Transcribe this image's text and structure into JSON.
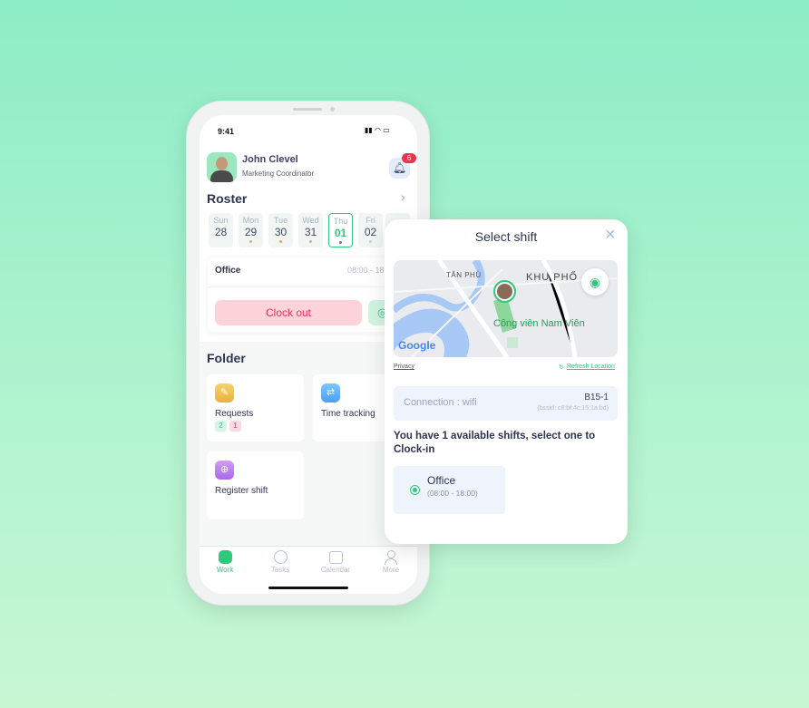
{
  "status_bar": {
    "time": "9:41"
  },
  "user": {
    "name": "John Clevel",
    "role": "Marketing Coordinator",
    "notification_count": "6"
  },
  "roster": {
    "title": "Roster",
    "days": [
      {
        "dow": "Sun",
        "date": "28",
        "dot": ""
      },
      {
        "dow": "Mon",
        "date": "29",
        "dot": "#f5a36b"
      },
      {
        "dow": "Tue",
        "date": "30",
        "dot": "#f5a36b"
      },
      {
        "dow": "Wed",
        "date": "31",
        "dot": "#f5a36b"
      },
      {
        "dow": "Thu",
        "date": "01",
        "dot": "#6b7489",
        "selected": true
      },
      {
        "dow": "Fri",
        "date": "02",
        "dot": "#c9d0d6"
      }
    ],
    "shift_name": "Office",
    "shift_time": "08:00 - 18:00",
    "clock_out_label": "Clock out"
  },
  "folder": {
    "title": "Folder",
    "items": [
      {
        "label": "Requests",
        "badges": [
          "2",
          "1"
        ],
        "icon": "requests-icon"
      },
      {
        "label": "Time tracking",
        "icon": "time-tracking-icon"
      },
      {
        "label": "Register shift",
        "icon": "register-shift-icon"
      }
    ]
  },
  "bottom_nav": [
    {
      "label": "Work",
      "active": true
    },
    {
      "label": "Tasks"
    },
    {
      "label": "Calendar"
    },
    {
      "label": "More"
    }
  ],
  "modal": {
    "title": "Select shift",
    "map": {
      "labels": [
        "TÂN PHÚ",
        "KHU PHỐ",
        "Công viên Nam Viên"
      ],
      "logo": "Google"
    },
    "privacy": "Privacy",
    "refresh": "Refresh Location",
    "connection": {
      "label": "Connection : wifi",
      "ssid": "B15-1",
      "bssid": "(bssid: c8:bf:4c:15:1a:bd)"
    },
    "prompt": "You have 1 available shifts, select one to Clock-in",
    "shift": {
      "name": "Office",
      "time": "(08:00 - 18:00)"
    }
  },
  "colors": {
    "accent": "#2fc97a",
    "danger": "#f0324f",
    "clock_out_bg": "#ffd3da"
  }
}
